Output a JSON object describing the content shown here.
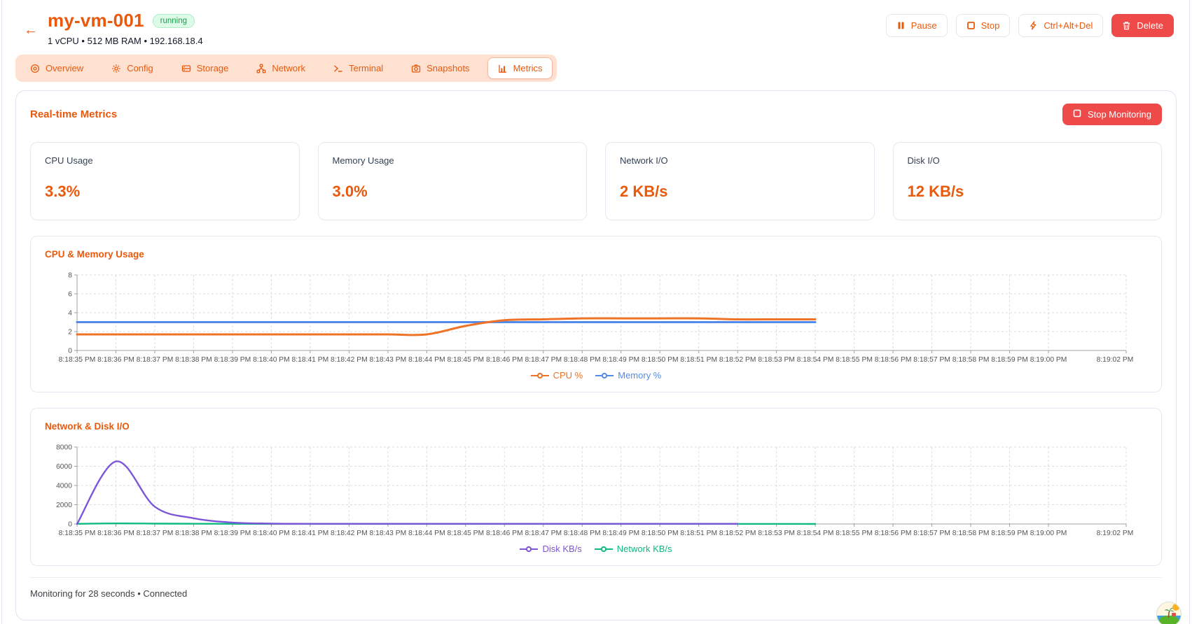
{
  "header": {
    "back_glyph": "←",
    "title": "my-vm-001",
    "status": "running",
    "subtitle": "1 vCPU • 512 MB RAM • 192.168.18.4",
    "actions": {
      "pause": "Pause",
      "stop": "Stop",
      "ctrl_alt_del": "Ctrl+Alt+Del",
      "delete": "Delete"
    }
  },
  "tabs": [
    {
      "label": "Overview",
      "icon": "eye-icon",
      "active": false
    },
    {
      "label": "Config",
      "icon": "gear-icon",
      "active": false
    },
    {
      "label": "Storage",
      "icon": "drive-icon",
      "active": false
    },
    {
      "label": "Network",
      "icon": "network-icon",
      "active": false
    },
    {
      "label": "Terminal",
      "icon": "terminal-icon",
      "active": false
    },
    {
      "label": "Snapshots",
      "icon": "camera-icon",
      "active": false
    },
    {
      "label": "Metrics",
      "icon": "bar-chart-icon",
      "active": true
    }
  ],
  "metrics_panel": {
    "heading": "Real-time Metrics",
    "stop_monitoring_label": "Stop Monitoring",
    "stat_cards": [
      {
        "label": "CPU Usage",
        "value": "3.3%"
      },
      {
        "label": "Memory Usage",
        "value": "3.0%"
      },
      {
        "label": "Network I/O",
        "value": "2 KB/s"
      },
      {
        "label": "Disk I/O",
        "value": "12 KB/s"
      }
    ],
    "footer": "Monitoring for 28 seconds • Connected"
  },
  "colors": {
    "accent_orange": "#e8590c",
    "danger_red": "#ef4a4a",
    "badge_green": "#16a34a",
    "cpu_line": "#ee7326",
    "memory_line": "#548ae9",
    "disk_line": "#7c56d9",
    "network_line": "#10b981"
  },
  "chart_data": [
    {
      "type": "line",
      "title": "CPU & Memory Usage",
      "xlabel": "",
      "ylabel": "",
      "x_range": [
        0,
        27
      ],
      "ylim": [
        0,
        8
      ],
      "y_ticks": [
        0,
        2,
        4,
        6,
        8
      ],
      "grid": true,
      "legend_position": "bottom",
      "x_ticks": [
        {
          "t": 0,
          "label": "8:18:35 PM"
        },
        {
          "t": 1,
          "label": "8:18:36 PM"
        },
        {
          "t": 2,
          "label": "8:18:37 PM"
        },
        {
          "t": 3,
          "label": "8:18:38 PM"
        },
        {
          "t": 4,
          "label": "8:18:39 PM"
        },
        {
          "t": 5,
          "label": "8:18:40 PM"
        },
        {
          "t": 6,
          "label": "8:18:41 PM"
        },
        {
          "t": 7,
          "label": "8:18:42 PM"
        },
        {
          "t": 8,
          "label": "8:18:43 PM"
        },
        {
          "t": 9,
          "label": "8:18:44 PM"
        },
        {
          "t": 10,
          "label": "8:18:45 PM"
        },
        {
          "t": 11,
          "label": "8:18:46 PM"
        },
        {
          "t": 12,
          "label": "8:18:47 PM"
        },
        {
          "t": 13,
          "label": "8:18:48 PM"
        },
        {
          "t": 14,
          "label": "8:18:49 PM"
        },
        {
          "t": 15,
          "label": "8:18:50 PM"
        },
        {
          "t": 16,
          "label": "8:18:51 PM"
        },
        {
          "t": 17,
          "label": "8:18:52 PM"
        },
        {
          "t": 18,
          "label": "8:18:53 PM"
        },
        {
          "t": 19,
          "label": "8:18:54 PM"
        },
        {
          "t": 20,
          "label": "8:18:55 PM"
        },
        {
          "t": 21,
          "label": "8:18:56 PM"
        },
        {
          "t": 22,
          "label": "8:18:57 PM"
        },
        {
          "t": 23,
          "label": "8:18:58 PM"
        },
        {
          "t": 24,
          "label": "8:18:59 PM"
        },
        {
          "t": 25,
          "label": "8:19:00 PM"
        },
        {
          "t": 27,
          "label": "8:19:02 PM"
        }
      ],
      "series": [
        {
          "name": "CPU %",
          "color": "#ee7326",
          "x": [
            0,
            1,
            2,
            3,
            4,
            5,
            6,
            7,
            8,
            9,
            10,
            11,
            12,
            13,
            14,
            15,
            16,
            17,
            18,
            19
          ],
          "values": [
            1.7,
            1.7,
            1.7,
            1.7,
            1.7,
            1.7,
            1.7,
            1.7,
            1.7,
            1.7,
            2.6,
            3.2,
            3.3,
            3.4,
            3.4,
            3.4,
            3.4,
            3.3,
            3.3,
            3.3
          ]
        },
        {
          "name": "Memory %",
          "color": "#548ae9",
          "x": [
            0,
            1,
            2,
            3,
            4,
            5,
            6,
            7,
            8,
            9,
            10,
            11,
            12,
            13,
            14,
            15,
            16,
            17,
            18,
            19
          ],
          "values": [
            3,
            3,
            3,
            3,
            3,
            3,
            3,
            3,
            3,
            3,
            3,
            3,
            3,
            3,
            3,
            3,
            3,
            3,
            3,
            3
          ]
        }
      ]
    },
    {
      "type": "line",
      "title": "Network & Disk I/O",
      "xlabel": "",
      "ylabel": "",
      "x_range": [
        0,
        27
      ],
      "ylim": [
        0,
        8000
      ],
      "y_ticks": [
        0,
        2000,
        4000,
        6000,
        8000
      ],
      "grid": true,
      "legend_position": "bottom",
      "x_ticks": [
        {
          "t": 0,
          "label": "8:18:35 PM"
        },
        {
          "t": 1,
          "label": "8:18:36 PM"
        },
        {
          "t": 2,
          "label": "8:18:37 PM"
        },
        {
          "t": 3,
          "label": "8:18:38 PM"
        },
        {
          "t": 4,
          "label": "8:18:39 PM"
        },
        {
          "t": 5,
          "label": "8:18:40 PM"
        },
        {
          "t": 6,
          "label": "8:18:41 PM"
        },
        {
          "t": 7,
          "label": "8:18:42 PM"
        },
        {
          "t": 8,
          "label": "8:18:43 PM"
        },
        {
          "t": 9,
          "label": "8:18:44 PM"
        },
        {
          "t": 10,
          "label": "8:18:45 PM"
        },
        {
          "t": 11,
          "label": "8:18:46 PM"
        },
        {
          "t": 12,
          "label": "8:18:47 PM"
        },
        {
          "t": 13,
          "label": "8:18:48 PM"
        },
        {
          "t": 14,
          "label": "8:18:49 PM"
        },
        {
          "t": 15,
          "label": "8:18:50 PM"
        },
        {
          "t": 16,
          "label": "8:18:51 PM"
        },
        {
          "t": 17,
          "label": "8:18:52 PM"
        },
        {
          "t": 18,
          "label": "8:18:53 PM"
        },
        {
          "t": 19,
          "label": "8:18:54 PM"
        },
        {
          "t": 20,
          "label": "8:18:55 PM"
        },
        {
          "t": 21,
          "label": "8:18:56 PM"
        },
        {
          "t": 22,
          "label": "8:18:57 PM"
        },
        {
          "t": 23,
          "label": "8:18:58 PM"
        },
        {
          "t": 24,
          "label": "8:18:59 PM"
        },
        {
          "t": 25,
          "label": "8:19:00 PM"
        },
        {
          "t": 27,
          "label": "8:19:02 PM"
        }
      ],
      "series": [
        {
          "name": "Disk KB/s",
          "color": "#7c56d9",
          "x": [
            0,
            1,
            2,
            3,
            4,
            5,
            6,
            7,
            8,
            9,
            10,
            11,
            12,
            13,
            14,
            15,
            16,
            17
          ],
          "values": [
            0,
            6500,
            1800,
            600,
            150,
            40,
            15,
            12,
            12,
            12,
            12,
            12,
            12,
            12,
            12,
            12,
            12,
            12
          ]
        },
        {
          "name": "Network KB/s",
          "color": "#10b981",
          "x": [
            0,
            1,
            2,
            3,
            4,
            5,
            6,
            7,
            8,
            9,
            10,
            11,
            12,
            13,
            14,
            15,
            16,
            17,
            18,
            19
          ],
          "values": [
            10,
            60,
            40,
            20,
            15,
            10,
            8,
            6,
            5,
            5,
            5,
            5,
            5,
            5,
            5,
            5,
            5,
            5,
            4,
            2
          ]
        }
      ]
    }
  ]
}
